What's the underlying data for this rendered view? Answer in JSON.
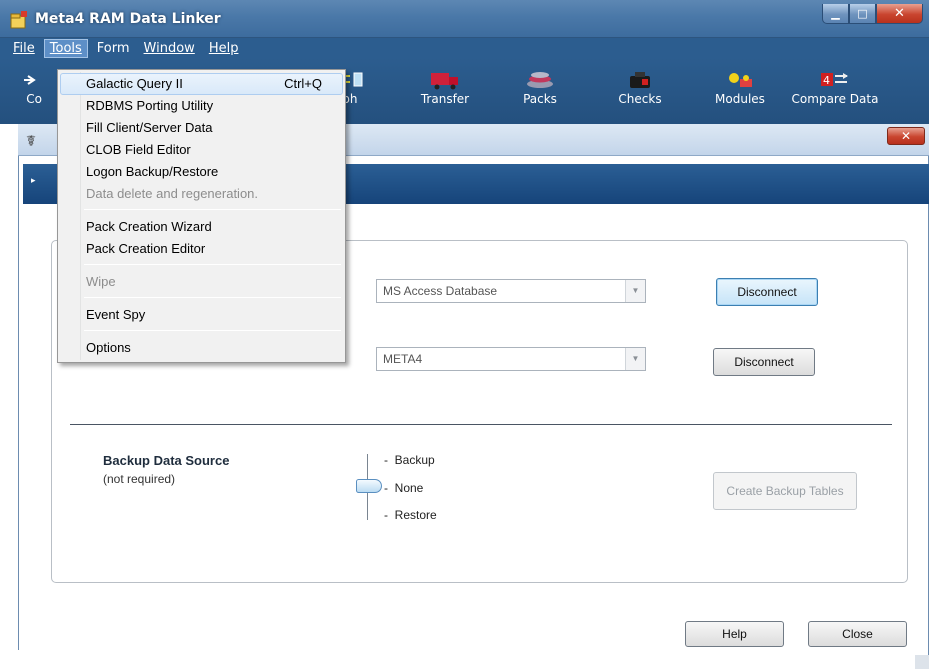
{
  "window": {
    "title": "Meta4 RAM Data Linker",
    "minimize_glyph": "▁",
    "maximize_glyph": "□",
    "close_glyph": "✕"
  },
  "menubar": {
    "items": [
      {
        "label": "File"
      },
      {
        "label": "Tools"
      },
      {
        "label": "Form"
      },
      {
        "label": "Window"
      },
      {
        "label": "Help"
      }
    ]
  },
  "toolbar": {
    "buttons": [
      {
        "label": "Co",
        "icon": "connect-icon"
      },
      {
        "label": "orph",
        "icon": "morph-icon"
      },
      {
        "label": "Transfer",
        "icon": "truck-icon"
      },
      {
        "label": "Packs",
        "icon": "packs-icon"
      },
      {
        "label": "Checks",
        "icon": "checks-icon"
      },
      {
        "label": "Modules",
        "icon": "modules-icon"
      },
      {
        "label": "Compare Data",
        "icon": "compare-data-icon"
      }
    ]
  },
  "tools_menu": {
    "items": [
      {
        "label": "Galactic Query II",
        "shortcut": "Ctrl+Q"
      },
      {
        "label": "RDBMS Porting Utility"
      },
      {
        "label": "Fill Client/Server Data"
      },
      {
        "label": "CLOB Field Editor"
      },
      {
        "label": "Logon Backup/Restore"
      },
      {
        "label": "Data delete and regeneration."
      },
      {
        "label": "Pack Creation Wizard"
      },
      {
        "label": "Pack Creation Editor"
      },
      {
        "label": "Wipe"
      },
      {
        "label": "Event Spy"
      },
      {
        "label": "Options"
      }
    ]
  },
  "child_window": {
    "close_glyph": "✕",
    "band_arrow": "▸"
  },
  "connections": {
    "source_combo": "MS Access Database",
    "target_combo": "META4",
    "disconnect_label": "Disconnect"
  },
  "backup": {
    "title": "Backup Data Source",
    "subtitle": "(not required)",
    "options": [
      "Backup",
      "None",
      "Restore"
    ],
    "create_button": "Create Backup Tables"
  },
  "footer": {
    "help_label": "Help",
    "close_label": "Close"
  }
}
